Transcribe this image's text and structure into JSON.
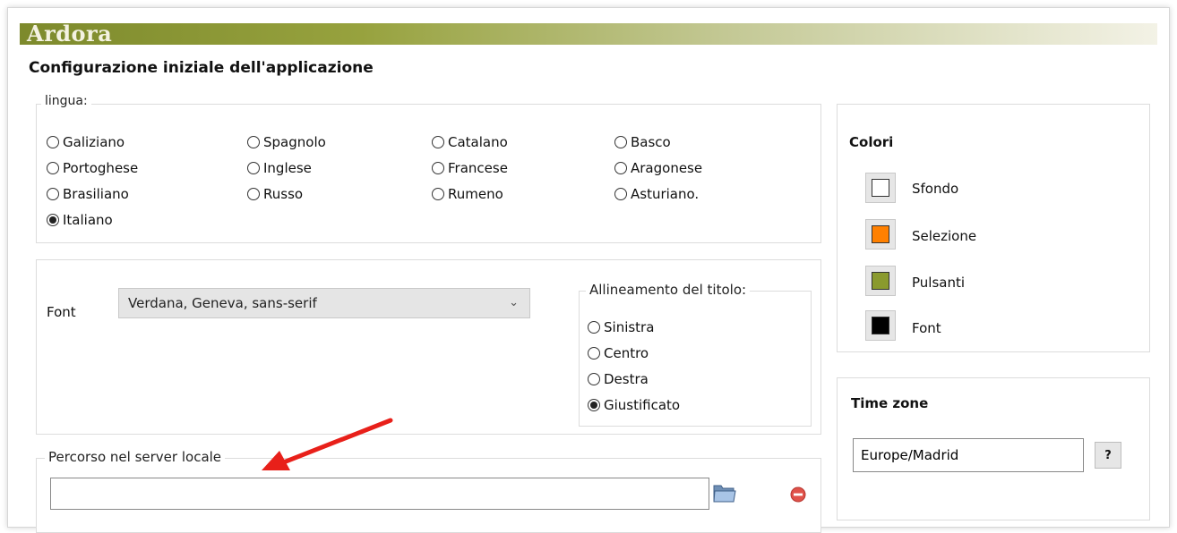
{
  "brand": {
    "name": "Ardora"
  },
  "page": {
    "title": "Configurazione iniziale dell'applicazione"
  },
  "language": {
    "legend": "lingua:",
    "options": [
      {
        "label": "Galiziano",
        "checked": false
      },
      {
        "label": "Spagnolo",
        "checked": false
      },
      {
        "label": "Catalano",
        "checked": false
      },
      {
        "label": "Basco",
        "checked": false
      },
      {
        "label": "Portoghese",
        "checked": false
      },
      {
        "label": "Inglese",
        "checked": false
      },
      {
        "label": "Francese",
        "checked": false
      },
      {
        "label": "Aragonese",
        "checked": false
      },
      {
        "label": "Brasiliano",
        "checked": false
      },
      {
        "label": "Russo",
        "checked": false
      },
      {
        "label": "Rumeno",
        "checked": false
      },
      {
        "label": "Asturiano.",
        "checked": false
      },
      {
        "label": "Italiano",
        "checked": true
      }
    ]
  },
  "font": {
    "label": "Font",
    "selected": "Verdana, Geneva, sans-serif"
  },
  "title_alignment": {
    "legend": "Allineamento del titolo:",
    "options": [
      {
        "label": "Sinistra",
        "checked": false
      },
      {
        "label": "Centro",
        "checked": false
      },
      {
        "label": "Destra",
        "checked": false
      },
      {
        "label": "Giustificato",
        "checked": true
      }
    ]
  },
  "colors": {
    "title": "Colori",
    "items": [
      {
        "label": "Sfondo",
        "color": "#ffffff"
      },
      {
        "label": "Selezione",
        "color": "#ff8000"
      },
      {
        "label": "Pulsanti",
        "color": "#8a9a2e"
      },
      {
        "label": "Font",
        "color": "#000000"
      }
    ]
  },
  "timezone": {
    "title": "Time zone",
    "value": "Europe/Madrid",
    "help_label": "?"
  },
  "local_path": {
    "legend": "Percorso nel server locale",
    "value": ""
  },
  "icons": {
    "folder": "folder-open-icon",
    "remove": "remove-minus-icon",
    "arrow": "red-arrow-icon"
  }
}
